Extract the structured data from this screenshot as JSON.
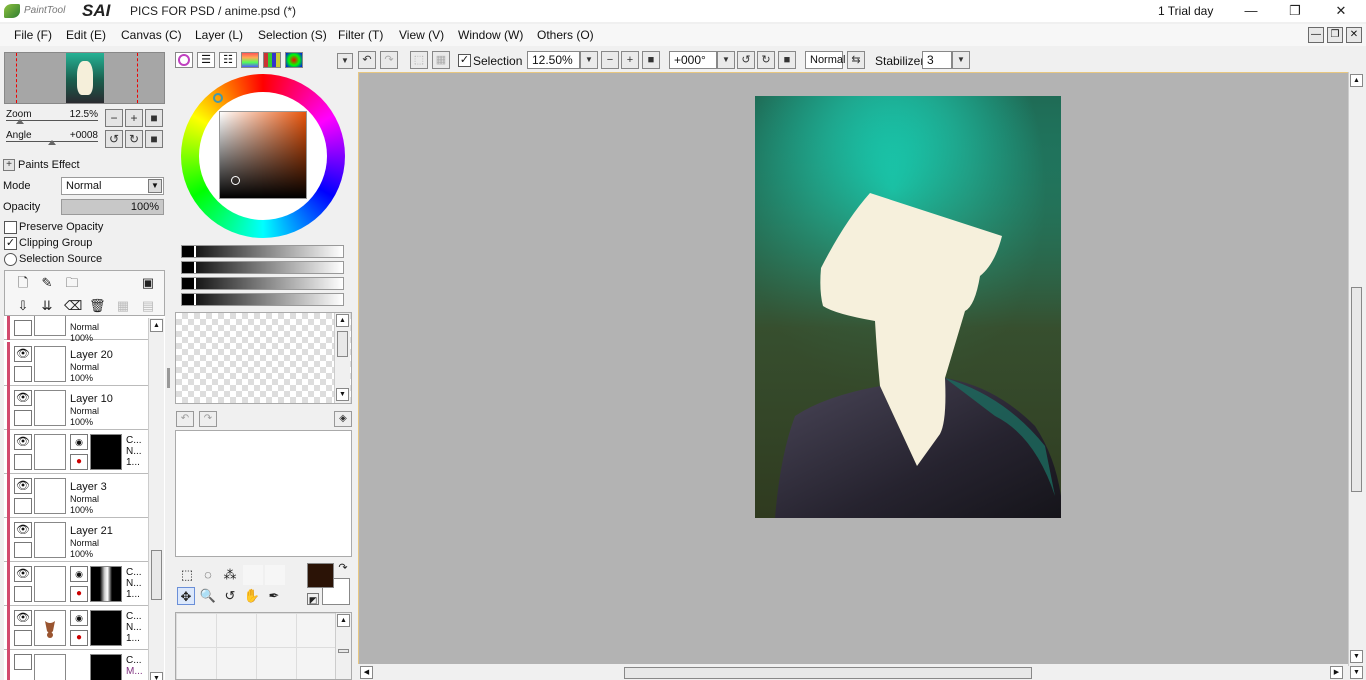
{
  "titlebar": {
    "logo_small": "PaintTool",
    "logo_big": "SAI",
    "title": "PICS FOR PSD / anime.psd (*)",
    "trial": "1 Trial day"
  },
  "menu": [
    "File (F)",
    "Edit (E)",
    "Canvas (C)",
    "Layer (L)",
    "Selection (S)",
    "Filter (T)",
    "View (V)",
    "Window (W)",
    "Others (O)"
  ],
  "navigator": {
    "zoom_label": "Zoom",
    "zoom_value": "12.5%",
    "angle_label": "Angle",
    "angle_value": "+0008"
  },
  "paint": {
    "effect_label": "Paints Effect",
    "mode_label": "Mode",
    "mode_value": "Normal",
    "opacity_label": "Opacity",
    "opacity_value": "100%",
    "opacity_fraction": 1.0,
    "preserve_label": "Preserve Opacity",
    "clipping_label": "Clipping Group",
    "selection_source_label": "Selection Source",
    "clipping_checked": true
  },
  "layers": [
    {
      "name": "",
      "mode": "Normal",
      "opacity": "100%"
    },
    {
      "name": "Layer 20",
      "mode": "Normal",
      "opacity": "100%"
    },
    {
      "name": "Layer 10",
      "mode": "Normal",
      "opacity": "100%"
    },
    {
      "name": "C...",
      "mode": "N...",
      "opacity": "1..."
    },
    {
      "name": "Layer 3",
      "mode": "Normal",
      "opacity": "100%"
    },
    {
      "name": "Layer 21",
      "mode": "Normal",
      "opacity": "100%"
    },
    {
      "name": "C...",
      "mode": "N...",
      "opacity": "1..."
    },
    {
      "name": "C...",
      "mode": "N...",
      "opacity": "1..."
    },
    {
      "name": "C...",
      "mode": "M...",
      "opacity": ""
    }
  ],
  "toolbar": {
    "selection_label": "Selection",
    "selection_checked": true,
    "zoom": "12.50%",
    "rotation": "+000°",
    "blend": "Normal",
    "stabilizer_label": "Stabilizer",
    "stabilizer_value": "3"
  },
  "colors": {
    "foreground": "#2b1306",
    "background": "#ffffff",
    "accent": "#e8540b"
  },
  "icons": {
    "hscroll_left": "◀",
    "hscroll_right": "▶",
    "vscroll_up": "▲",
    "vscroll_down": "▼",
    "combo_down": "▼",
    "eye": "👁",
    "close": "✕",
    "minimize": "—",
    "maximize": "❐",
    "plus": "+",
    "minus": "−"
  }
}
